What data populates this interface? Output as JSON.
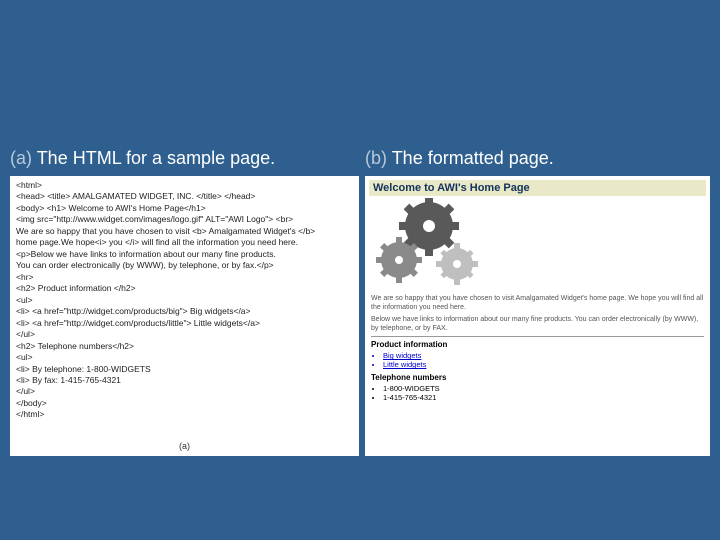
{
  "captions": {
    "a_label": "(a) ",
    "a_text": "The HTML for a sample page.",
    "b_label": "(b) ",
    "b_text": "The formatted page."
  },
  "source": {
    "lines": [
      "<html>",
      "<head> <title> AMALGAMATED   WIDGET, INC. </title> </head>",
      "<body> <h1> Welcome to AWI's Home Page</h1>",
      "<img src=\"http://www.widget.com/images/logo.gif\" ALT=\"AWI Logo\"> <br>",
      "We are so happy that you have chosen to visit <b> Amalgamated Widget's </b>",
      "home page.We hope<i> you </i> will find all the information you need here.",
      "<p>Below we have links to information about our many fine products.",
      "You can order electronically (by WWW), by telephone, or by fax.</p>",
      "<hr>",
      "<h2> Product information </h2>",
      "<ul>",
      "   <li> <a href=\"http://widget.com/products/big\">  Big widgets</a>",
      "   <li> <a href=\"http://widget.com/products/little\">  Little widgets</a>",
      "</ul>",
      "<h2> Telephone numbers</h2>",
      "<ul>",
      "   <li> By telephone: 1-800-WIDGETS",
      "   <li> By fax: 1-415-765-4321",
      "</ul>",
      "</body>",
      "</html>"
    ],
    "figlabel": "(a)"
  },
  "rendered": {
    "title": "Welcome to AWI's Home Page",
    "para1": "We are so happy that you have chosen to visit Amalgamated Widget's home page. We hope you will find all the information you need here.",
    "para2": "Below we have links to information about our many fine products. You can order electronically (by WWW), by telephone, or by FAX.",
    "sect1": "Product information",
    "items1": [
      "Big widgets",
      "Little widgets"
    ],
    "sect2": "Telephone numbers",
    "items2": [
      "1-800-WIDGETS",
      "1-415-765-4321"
    ]
  }
}
